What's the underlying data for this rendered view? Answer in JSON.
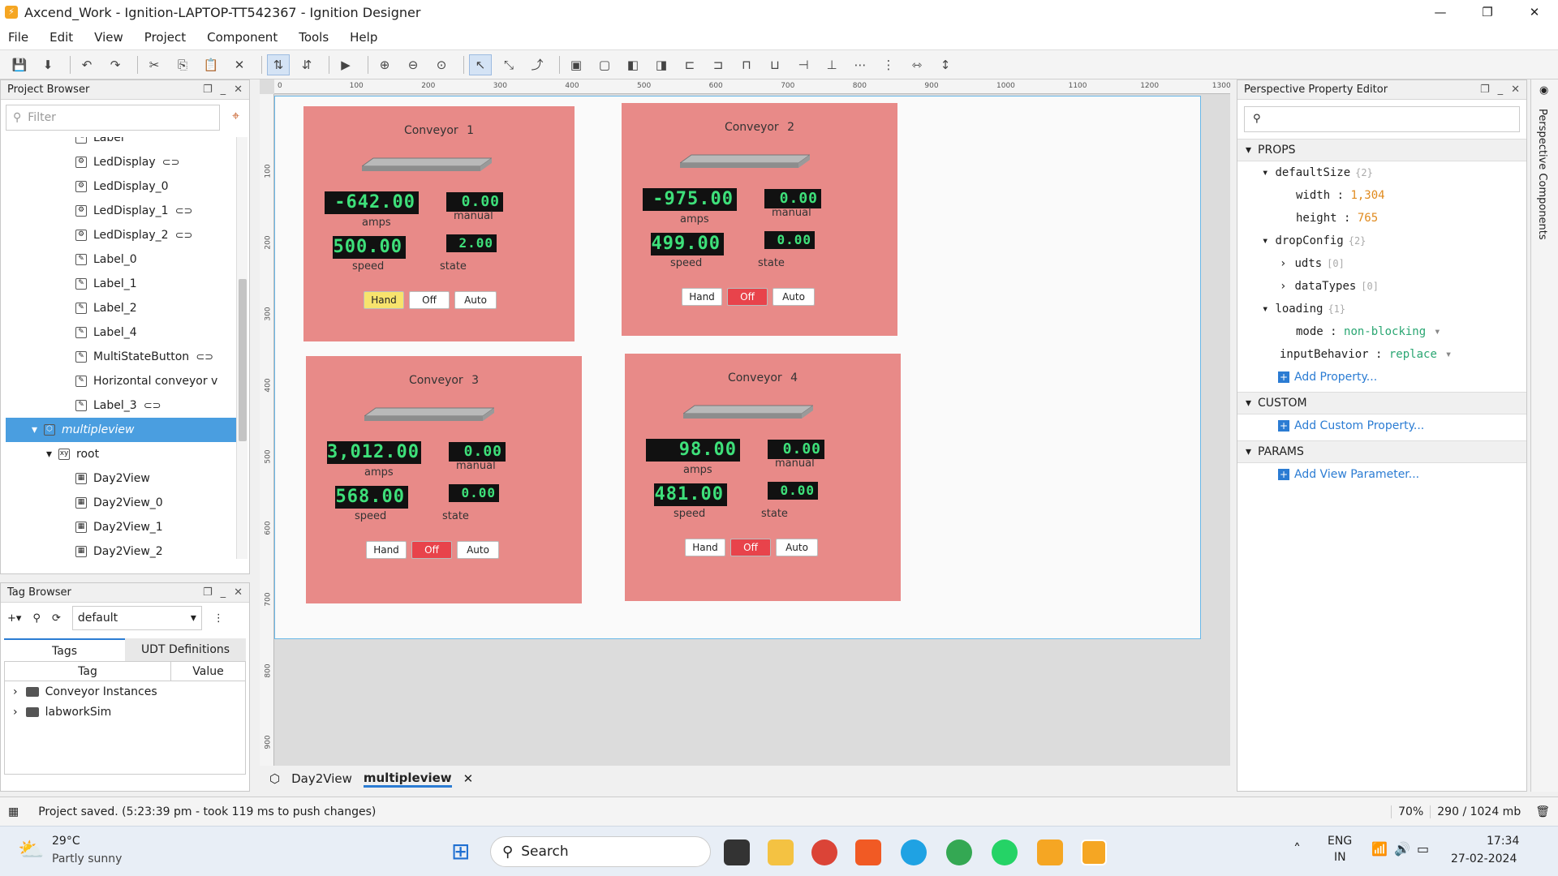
{
  "window": {
    "title": "Axcend_Work - Ignition-LAPTOP-TT542367 - Ignition Designer",
    "min": "—",
    "max": "❐",
    "close": "✕"
  },
  "menu": [
    "File",
    "Edit",
    "View",
    "Project",
    "Component",
    "Tools",
    "Help"
  ],
  "project_browser": {
    "title": "Project Browser",
    "filter_placeholder": "Filter",
    "items": [
      {
        "label": "Label",
        "linked": false,
        "indent": 5
      },
      {
        "label": "LedDisplay",
        "linked": true,
        "indent": 5
      },
      {
        "label": "LedDisplay_0",
        "linked": false,
        "indent": 5
      },
      {
        "label": "LedDisplay_1",
        "linked": true,
        "indent": 5
      },
      {
        "label": "LedDisplay_2",
        "linked": true,
        "indent": 5
      },
      {
        "label": "Label_0",
        "linked": false,
        "indent": 5
      },
      {
        "label": "Label_1",
        "linked": false,
        "indent": 5
      },
      {
        "label": "Label_2",
        "linked": false,
        "indent": 5
      },
      {
        "label": "Label_4",
        "linked": false,
        "indent": 5
      },
      {
        "label": "MultiStateButton",
        "linked": true,
        "indent": 5
      },
      {
        "label": "Horizontal conveyor v",
        "linked": false,
        "indent": 5
      },
      {
        "label": "Label_3",
        "linked": true,
        "indent": 5
      },
      {
        "label": "multipleview",
        "linked": false,
        "indent": 2,
        "selected": true
      },
      {
        "label": "root",
        "linked": false,
        "indent": 3
      },
      {
        "label": "Day2View",
        "linked": false,
        "indent": 5
      },
      {
        "label": "Day2View_0",
        "linked": false,
        "indent": 5
      },
      {
        "label": "Day2View_1",
        "linked": false,
        "indent": 5
      },
      {
        "label": "Day2View_2",
        "linked": false,
        "indent": 5
      }
    ]
  },
  "tag_browser": {
    "title": "Tag Browser",
    "provider": "default",
    "tabs": [
      "Tags",
      "UDT Definitions"
    ],
    "columns": [
      "Tag",
      "Value"
    ],
    "rows": [
      "Conveyor Instances",
      "labworkSim"
    ]
  },
  "ruler": {
    "h": [
      "0",
      "100",
      "200",
      "300",
      "400",
      "500",
      "600",
      "700",
      "800",
      "900",
      "1000",
      "1100",
      "1200",
      "1300"
    ],
    "v": [
      "100",
      "200",
      "300",
      "400",
      "500",
      "600",
      "700",
      "800",
      "900"
    ]
  },
  "conveyors": [
    {
      "title": "Conveyor   1",
      "amps": "-642.00",
      "manual": "0.00",
      "speed": "500.00",
      "state": "2.00",
      "mode": "Hand"
    },
    {
      "title": "Conveyor   2",
      "amps": "-975.00",
      "manual": "0.00",
      "speed": "499.00",
      "state": "0.00",
      "mode": "Off"
    },
    {
      "title": "Conveyor   3",
      "amps": "3,012.00",
      "manual": "0.00",
      "speed": "568.00",
      "state": "0.00",
      "mode": "Off"
    },
    {
      "title": "Conveyor   4",
      "amps": "98.00",
      "manual": "0.00",
      "speed": "481.00",
      "state": "0.00",
      "mode": "Off"
    }
  ],
  "labels": {
    "amps": "amps",
    "manual": "manual",
    "speed": "speed",
    "state": "state",
    "hand": "Hand",
    "off": "Off",
    "auto": "Auto"
  },
  "doc_tabs": [
    "Day2View",
    "multipleview"
  ],
  "property_editor": {
    "title": "Perspective Property Editor",
    "sections": {
      "props": "PROPS",
      "custom": "CUSTOM",
      "params": "PARAMS"
    },
    "defaultSize": {
      "key": "defaultSize",
      "count": "{2}",
      "width_key": "width",
      "width": "1,304",
      "height_key": "height",
      "height": "765"
    },
    "dropConfig": {
      "key": "dropConfig",
      "count": "{2}",
      "udts": "udts",
      "udts_count": "[0]",
      "dataTypes": "dataTypes",
      "dataTypes_count": "[0]"
    },
    "loading": {
      "key": "loading",
      "count": "{1}",
      "mode_key": "mode",
      "mode": "non-blocking"
    },
    "inputBehavior": {
      "key": "inputBehavior",
      "value": "replace"
    },
    "add_property": "Add Property...",
    "add_custom": "Add Custom Property...",
    "add_param": "Add View Parameter..."
  },
  "side_tab": "Perspective Components",
  "status": {
    "message": "Project saved. (5:23:39 pm - took 119 ms to push changes)",
    "zoom": "70%",
    "memory": "290 / 1024 mb"
  },
  "taskbar": {
    "weather_temp": "29°C",
    "weather_desc": "Partly sunny",
    "search": "Search",
    "lang": "ENG",
    "region": "IN",
    "time": "17:34",
    "date": "27-02-2024"
  },
  "colors": {
    "panel_bg": "#e88a88",
    "led_text": "#3ee07a",
    "selected": "#4a9ee0",
    "off_active": "#e8434b",
    "hand_active": "#f7e36d"
  }
}
